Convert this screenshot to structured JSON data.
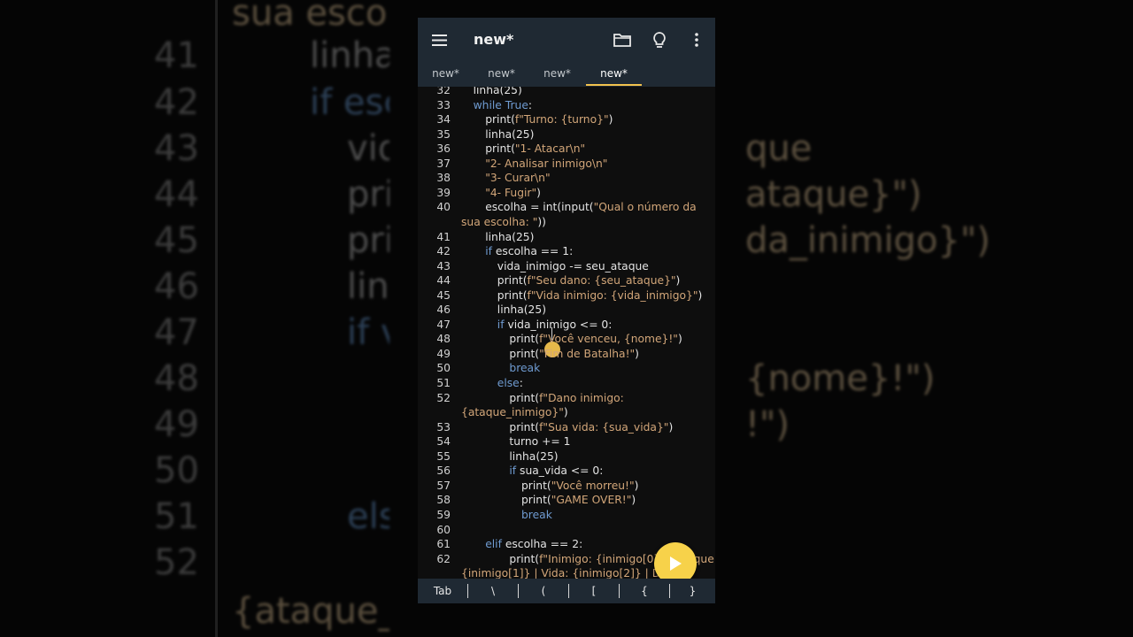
{
  "app": {
    "title": "new*",
    "tabs": [
      "new*",
      "new*",
      "new*",
      "new*"
    ],
    "active_tab": 3
  },
  "icons": {
    "menu": "hamburger-menu-icon",
    "folder": "folder-icon",
    "bulb": "lightbulb-icon",
    "more": "more-vert-icon",
    "run": "play-icon"
  },
  "colors": {
    "appbar": "#1f2933",
    "accent": "#f2c24e",
    "keyword": "#6f9bd1",
    "string": "#d2a679",
    "background": "#0e0e0e"
  },
  "editor": {
    "lines": [
      {
        "n": "32",
        "indent": 1,
        "parts": [
          {
            "t": "linha(25)"
          }
        ]
      },
      {
        "n": "33",
        "indent": 1,
        "parts": [
          {
            "t": "while",
            "c": "kw"
          },
          {
            "t": " "
          },
          {
            "t": "True",
            "c": "kw"
          },
          {
            "t": ":"
          }
        ]
      },
      {
        "n": "34",
        "indent": 2,
        "parts": [
          {
            "t": "print("
          },
          {
            "t": "f\"Turno: {turno}\"",
            "c": "str"
          },
          {
            "t": ")"
          }
        ]
      },
      {
        "n": "35",
        "indent": 2,
        "parts": [
          {
            "t": "linha(25)"
          }
        ]
      },
      {
        "n": "36",
        "indent": 2,
        "parts": [
          {
            "t": "print("
          },
          {
            "t": "\"1- Atacar\\n\"",
            "c": "str"
          }
        ]
      },
      {
        "n": "37",
        "indent": 2,
        "parts": [
          {
            "t": "\"2- Analisar inimigo\\n\"",
            "c": "str"
          }
        ]
      },
      {
        "n": "38",
        "indent": 2,
        "parts": [
          {
            "t": "\"3- Curar\\n\"",
            "c": "str"
          }
        ]
      },
      {
        "n": "39",
        "indent": 2,
        "parts": [
          {
            "t": "\"4- Fugir\"",
            "c": "str"
          },
          {
            "t": ")"
          }
        ]
      },
      {
        "n": "40",
        "indent": 2,
        "parts": [
          {
            "t": "escolha = int(input("
          },
          {
            "t": "\"Qual o número da",
            "c": "str"
          }
        ]
      },
      {
        "n": "",
        "indent": 0,
        "parts": [
          {
            "t": "sua escolha: \"",
            "c": "str"
          },
          {
            "t": "))"
          }
        ]
      },
      {
        "n": "41",
        "indent": 2,
        "parts": [
          {
            "t": "linha(25)"
          }
        ]
      },
      {
        "n": "42",
        "indent": 2,
        "parts": [
          {
            "t": "if",
            "c": "kw"
          },
          {
            "t": " escolha == 1:"
          }
        ]
      },
      {
        "n": "43",
        "indent": 3,
        "parts": [
          {
            "t": "vida_inimigo -= seu_ataque"
          }
        ]
      },
      {
        "n": "44",
        "indent": 3,
        "parts": [
          {
            "t": "print("
          },
          {
            "t": "f\"Seu dano: {seu_ataque}\"",
            "c": "str"
          },
          {
            "t": ")"
          }
        ]
      },
      {
        "n": "45",
        "indent": 3,
        "parts": [
          {
            "t": "print("
          },
          {
            "t": "f\"Vida inimigo: {vida_inimigo}\"",
            "c": "str"
          },
          {
            "t": ")"
          }
        ]
      },
      {
        "n": "46",
        "indent": 3,
        "parts": [
          {
            "t": "linha(25)"
          }
        ]
      },
      {
        "n": "47",
        "indent": 3,
        "parts": [
          {
            "t": "if",
            "c": "kw"
          },
          {
            "t": " vida_inimigo <= 0:"
          }
        ]
      },
      {
        "n": "48",
        "indent": 4,
        "parts": [
          {
            "t": "print("
          },
          {
            "t": "f\"Você venceu, {nome}!\"",
            "c": "str"
          },
          {
            "t": ")"
          }
        ]
      },
      {
        "n": "49",
        "indent": 4,
        "parts": [
          {
            "t": "print("
          },
          {
            "t": "\"Fim de Batalha!\"",
            "c": "str"
          },
          {
            "t": ")"
          }
        ]
      },
      {
        "n": "50",
        "indent": 4,
        "parts": [
          {
            "t": "break",
            "c": "kw"
          }
        ]
      },
      {
        "n": "51",
        "indent": 3,
        "parts": [
          {
            "t": "else",
            "c": "kw"
          },
          {
            "t": ":"
          }
        ]
      },
      {
        "n": "52",
        "indent": 4,
        "parts": [
          {
            "t": "print("
          },
          {
            "t": "f\"Dano inimigo:",
            "c": "str"
          }
        ]
      },
      {
        "n": "",
        "indent": 0,
        "parts": [
          {
            "t": "{ataque_inimigo}\"",
            "c": "str"
          },
          {
            "t": ")"
          }
        ]
      },
      {
        "n": "53",
        "indent": 4,
        "parts": [
          {
            "t": "print("
          },
          {
            "t": "f\"Sua vida: {sua_vida}\"",
            "c": "str"
          },
          {
            "t": ")"
          }
        ]
      },
      {
        "n": "54",
        "indent": 4,
        "parts": [
          {
            "t": "turno += 1"
          }
        ]
      },
      {
        "n": "55",
        "indent": 4,
        "parts": [
          {
            "t": "linha(25)"
          }
        ]
      },
      {
        "n": "56",
        "indent": 4,
        "parts": [
          {
            "t": "if",
            "c": "kw"
          },
          {
            "t": " sua_vida <= 0:"
          }
        ]
      },
      {
        "n": "57",
        "indent": 5,
        "parts": [
          {
            "t": "print("
          },
          {
            "t": "\"Você morreu!\"",
            "c": "str"
          },
          {
            "t": ")"
          }
        ]
      },
      {
        "n": "58",
        "indent": 5,
        "parts": [
          {
            "t": "print("
          },
          {
            "t": "\"GAME OVER!\"",
            "c": "str"
          },
          {
            "t": ")"
          }
        ]
      },
      {
        "n": "59",
        "indent": 5,
        "parts": [
          {
            "t": "break",
            "c": "kw"
          }
        ]
      },
      {
        "n": "60",
        "indent": 0,
        "parts": []
      },
      {
        "n": "61",
        "indent": 2,
        "parts": [
          {
            "t": "elif",
            "c": "kw"
          },
          {
            "t": " escolha == 2:"
          }
        ]
      },
      {
        "n": "62",
        "indent": 4,
        "parts": [
          {
            "t": "print("
          },
          {
            "t": "f\"Inimigo: {inimigo[0]} | Ataque:",
            "c": "str"
          }
        ]
      },
      {
        "n": "",
        "indent": 0,
        "parts": [
          {
            "t": "{inimigo[1]} | Vida: {inimigo[2]} | Dano",
            "c": "str"
          }
        ]
      }
    ]
  },
  "keybar": [
    "Tab",
    "\\",
    "(",
    "[",
    "{",
    "}"
  ],
  "background": {
    "left": [
      {
        "text": "sua esco",
        "c": "str"
      },
      {
        "num": "41",
        "text": "linha"
      },
      {
        "num": "42",
        "text": "if esc",
        "c": "kw"
      },
      {
        "num": "43",
        "text": "vid"
      },
      {
        "num": "44",
        "text": "pri"
      },
      {
        "num": "45",
        "text": "pri"
      },
      {
        "num": "46",
        "text": "lin"
      },
      {
        "num": "47",
        "text": "if v",
        "c": "kw"
      },
      {
        "num": "48",
        "text": ""
      },
      {
        "num": "49",
        "text": ""
      },
      {
        "num": "50",
        "text": ""
      },
      {
        "num": "51",
        "text": "els",
        "c": "kw"
      },
      {
        "num": "52",
        "text": ""
      },
      {
        "text": "{ataque_i",
        "c": "str"
      }
    ],
    "right": [
      {
        "text": "que",
        "c": "str"
      },
      {
        "text": "ataque}\")",
        "c": "str"
      },
      {
        "text": "da_inimigo}\")",
        "c": "str"
      },
      {
        "text": "{nome}!\")",
        "c": "str"
      },
      {
        "text": "!\")",
        "c": "str"
      }
    ]
  }
}
